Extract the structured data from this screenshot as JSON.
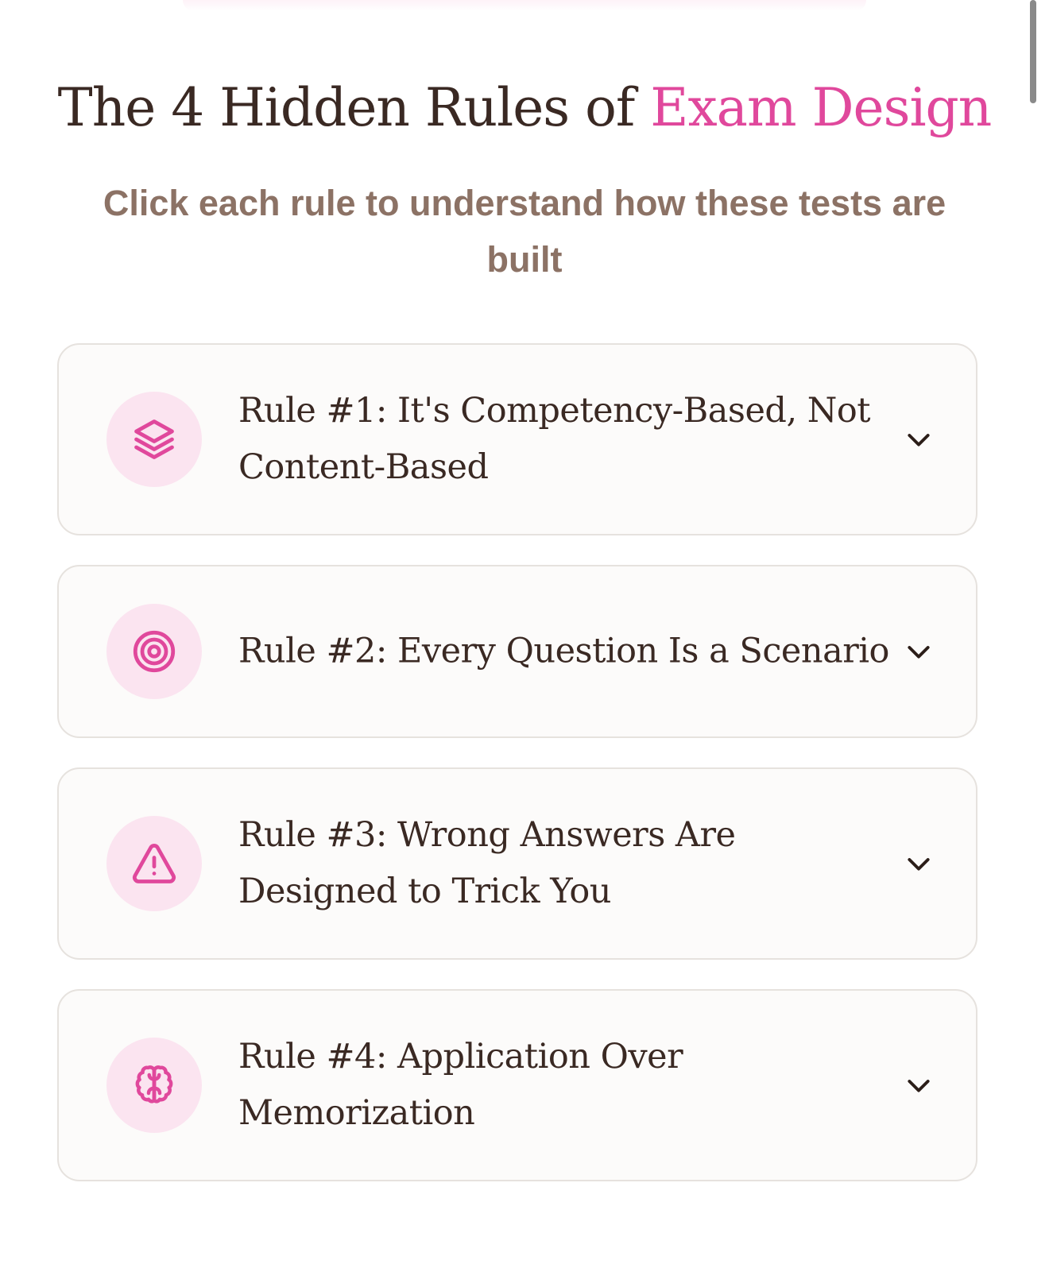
{
  "page": {
    "title_prefix": "The 4 Hidden Rules of ",
    "title_accent": "Exam Design",
    "subtitle": "Click each rule to understand how these tests are built"
  },
  "colors": {
    "accent": "#e0489c",
    "heading": "#3a2923",
    "subtitle": "#8c7265",
    "icon_bg": "#fbe4f0",
    "card_border": "#e6e2de",
    "card_bg": "#fcfbfa"
  },
  "rules": [
    {
      "title": "Rule #1: It's Competency-Based, Not Content-Based",
      "icon": "layers-icon",
      "expanded": false
    },
    {
      "title": "Rule #2: Every Question Is a Scenario",
      "icon": "target-icon",
      "expanded": false
    },
    {
      "title": "Rule #3: Wrong Answers Are Designed to Trick You",
      "icon": "warning-triangle-icon",
      "expanded": false
    },
    {
      "title": "Rule #4: Application Over Memorization",
      "icon": "brain-icon",
      "expanded": false
    }
  ]
}
